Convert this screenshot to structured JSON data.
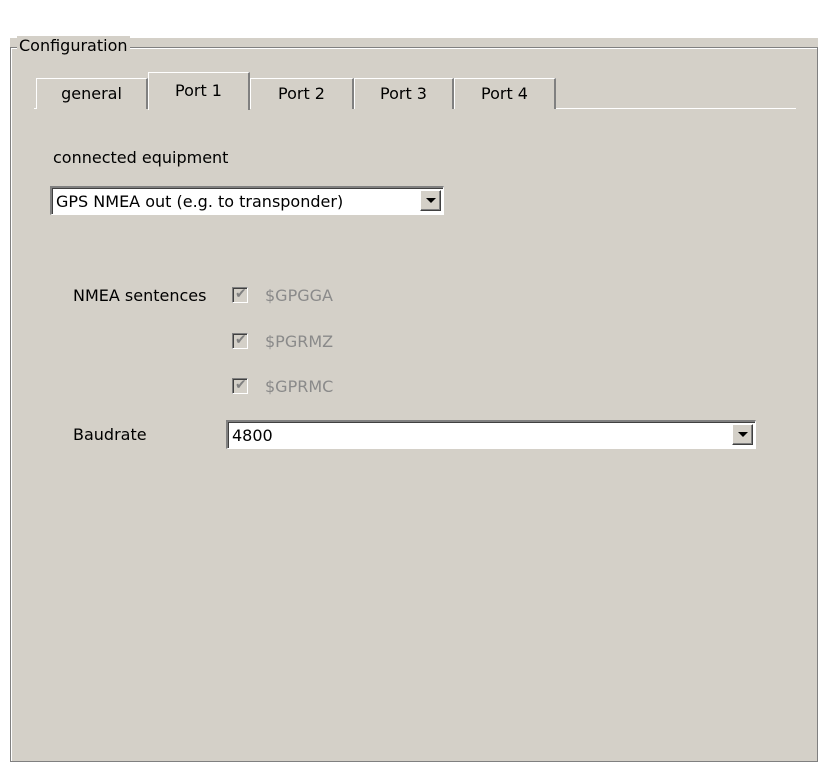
{
  "group": {
    "title": "Configuration"
  },
  "tabs": [
    {
      "label": "general"
    },
    {
      "label": "Port 1",
      "active": true
    },
    {
      "label": "Port 2"
    },
    {
      "label": "Port 3"
    },
    {
      "label": "Port 4"
    }
  ],
  "equipment": {
    "label": "connected equipment",
    "value": "GPS NMEA out (e.g. to transponder)",
    "icon": "chevron-down-icon"
  },
  "nmea": {
    "label": "NMEA sentences",
    "items": [
      {
        "label": "$GPGGA",
        "checked": true,
        "enabled": false
      },
      {
        "label": "$PGRMZ",
        "checked": true,
        "enabled": false
      },
      {
        "label": "$GPRMC",
        "checked": true,
        "enabled": false
      }
    ]
  },
  "baudrate": {
    "label": "Baudrate",
    "value": "4800",
    "icon": "chevron-down-icon"
  },
  "colors": {
    "panel": "#d4d0c8",
    "disabled_text": "#8a8a8a"
  }
}
